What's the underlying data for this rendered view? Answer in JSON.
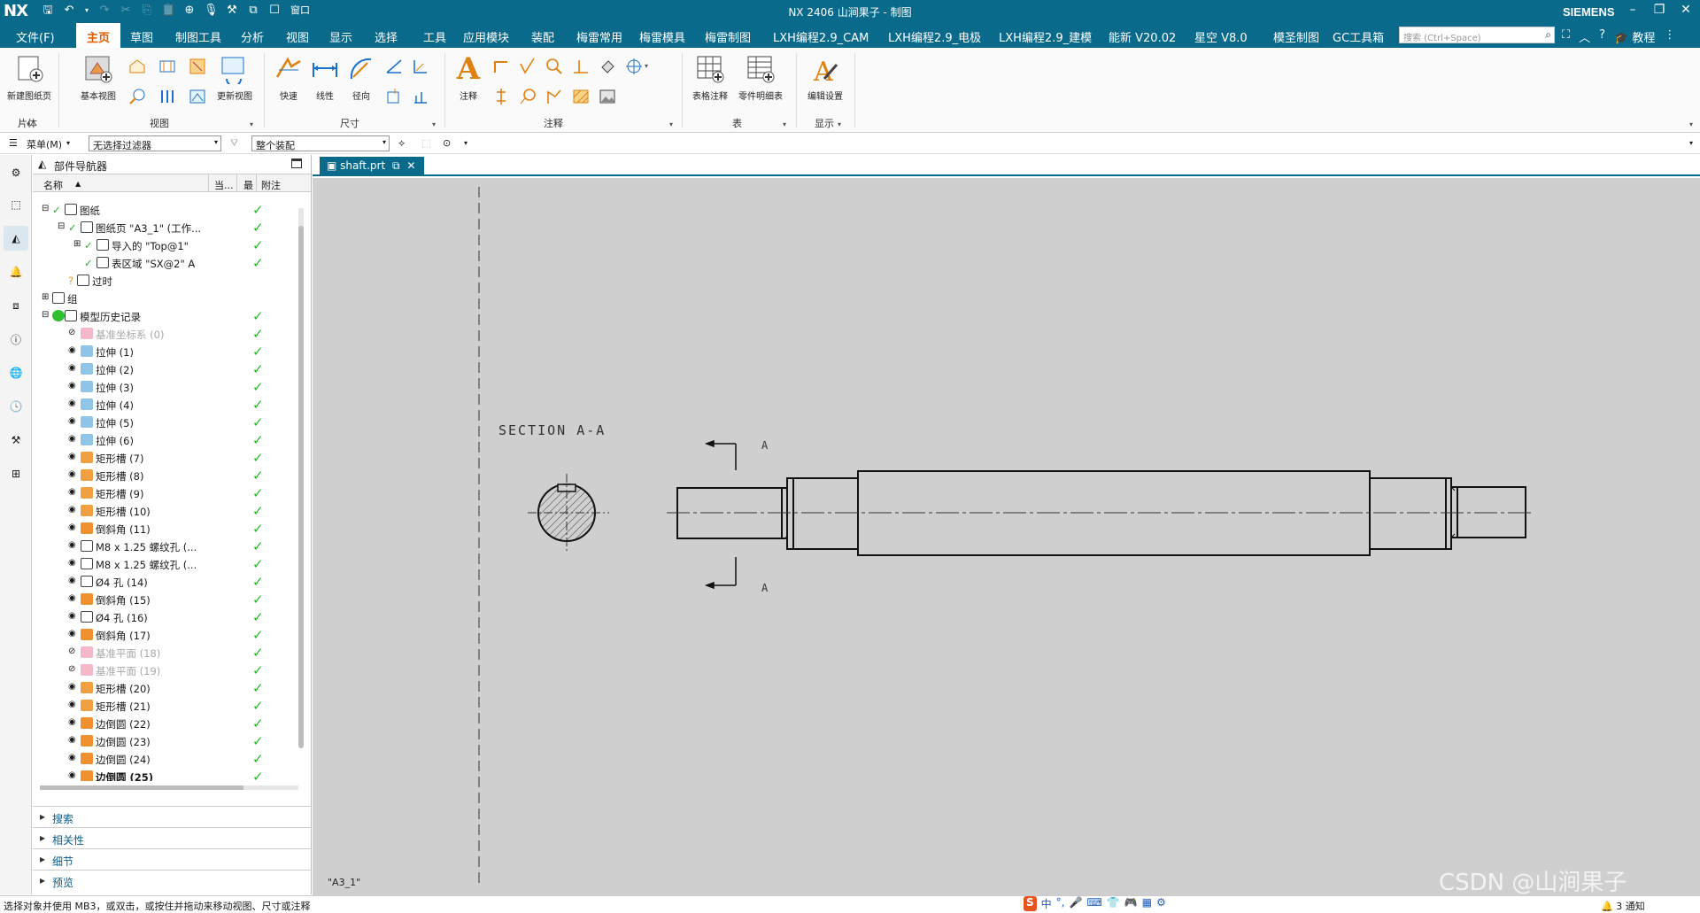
{
  "app": {
    "logo": "NX",
    "title": "NX 2406 山涧果子 - 制图",
    "brand": "SIEMENS",
    "window_label": "窗口"
  },
  "menu": {
    "items": [
      "文件(F)",
      "主页",
      "草图",
      "制图工具",
      "分析",
      "视图",
      "显示",
      "选择",
      "工具",
      "应用模块",
      "装配",
      "梅雷常用",
      "梅雷模具",
      "梅雷制图",
      "LXH编程2.9_CAM",
      "LXH编程2.9_电极",
      "LXH编程2.9_建模",
      "能新 V20.02",
      "星空 V8.0",
      "模圣制图",
      "GC工具箱"
    ],
    "active": "主页",
    "search_placeholder": "搜索 (Ctrl+Space)",
    "tutorial": "教程"
  },
  "ribbon": {
    "groups": [
      "片体",
      "视图",
      "尺寸",
      "注释",
      "表",
      "显示"
    ],
    "buttons": {
      "new_sheet": "新建图纸页",
      "base_view": "基本视图",
      "update_view": "更新视图",
      "quick": "快速",
      "linear": "线性",
      "radial": "径向",
      "note": "注释",
      "table_note": "表格注释",
      "parts_list": "零件明细表",
      "edit_settings": "编辑设置"
    }
  },
  "toolbar2": {
    "menu": "菜单(M)",
    "filter": "无选择过滤器",
    "assembly": "整个装配"
  },
  "navigator": {
    "title": "部件导航器",
    "columns": [
      "名称",
      "当...",
      "最",
      "附注"
    ],
    "sections": [
      "搜索",
      "相关性",
      "细节",
      "预览"
    ]
  },
  "tree": [
    {
      "label": "图纸",
      "indent": 0,
      "exp": "−",
      "check": true,
      "tick": true
    },
    {
      "label": "图纸页 \"A3_1\" (工作...",
      "indent": 1,
      "exp": "−",
      "check": true,
      "tick": true
    },
    {
      "label": "导入的 \"Top@1\"",
      "indent": 2,
      "exp": "+",
      "check": true,
      "tick": true
    },
    {
      "label": "表区域 \"SX@2\" A",
      "indent": 2,
      "exp": "",
      "check": true,
      "tick": true
    },
    {
      "label": "过时",
      "indent": 1,
      "exp": "",
      "check": false,
      "tick": false,
      "q": true
    },
    {
      "label": "组",
      "indent": 0,
      "exp": "+",
      "check": false,
      "tick": false
    },
    {
      "label": "模型历史记录",
      "indent": 0,
      "exp": "−",
      "check": false,
      "tick": true,
      "green": true
    },
    {
      "label": "基准坐标系 (0)",
      "indent": 1,
      "grey": true,
      "tick": true
    },
    {
      "label": "拉伸 (1)",
      "indent": 1,
      "tick": true
    },
    {
      "label": "拉伸 (2)",
      "indent": 1,
      "tick": true
    },
    {
      "label": "拉伸 (3)",
      "indent": 1,
      "tick": true
    },
    {
      "label": "拉伸 (4)",
      "indent": 1,
      "tick": true
    },
    {
      "label": "拉伸 (5)",
      "indent": 1,
      "tick": true
    },
    {
      "label": "拉伸 (6)",
      "indent": 1,
      "tick": true
    },
    {
      "label": "矩形槽 (7)",
      "indent": 1,
      "tick": true
    },
    {
      "label": "矩形槽 (8)",
      "indent": 1,
      "tick": true
    },
    {
      "label": "矩形槽 (9)",
      "indent": 1,
      "tick": true
    },
    {
      "label": "矩形槽 (10)",
      "indent": 1,
      "tick": true
    },
    {
      "label": "倒斜角 (11)",
      "indent": 1,
      "tick": true
    },
    {
      "label": "M8 x 1.25 螺纹孔 (...",
      "indent": 1,
      "tick": true
    },
    {
      "label": "M8 x 1.25 螺纹孔 (...",
      "indent": 1,
      "tick": true
    },
    {
      "label": "Ø4 孔 (14)",
      "indent": 1,
      "tick": true
    },
    {
      "label": "倒斜角 (15)",
      "indent": 1,
      "tick": true
    },
    {
      "label": "Ø4 孔 (16)",
      "indent": 1,
      "tick": true
    },
    {
      "label": "倒斜角 (17)",
      "indent": 1,
      "tick": true
    },
    {
      "label": "基准平面 (18)",
      "indent": 1,
      "grey": true,
      "tick": true
    },
    {
      "label": "基准平面 (19)",
      "indent": 1,
      "grey": true,
      "tick": true
    },
    {
      "label": "矩形槽 (20)",
      "indent": 1,
      "tick": true
    },
    {
      "label": "矩形槽 (21)",
      "indent": 1,
      "tick": true
    },
    {
      "label": "边倒圆 (22)",
      "indent": 1,
      "tick": true
    },
    {
      "label": "边倒圆 (23)",
      "indent": 1,
      "tick": true
    },
    {
      "label": "边倒圆 (24)",
      "indent": 1,
      "tick": true
    },
    {
      "label": "边倒圆 (25)",
      "indent": 1,
      "tick": true
    }
  ],
  "tab": {
    "label": "shaft.prt"
  },
  "drawing": {
    "section_label": "SECTION  A-A",
    "cut_letter": "A",
    "sheet_label": "\"A3_1\""
  },
  "status": {
    "message": "选择对象并使用 MB3，或双击，或按住并拖动来移动视图、尺寸或注释",
    "notifications": "3 通知",
    "ime": [
      "S",
      "中",
      "°,",
      "🎤",
      "⌨",
      "👕",
      "🎮",
      "▦",
      "⚙"
    ]
  },
  "watermark": "CSDN @山涧果子",
  "colors": {
    "title_bg": "#0a6a8c",
    "active_menu": "#e05a00",
    "canvas": "#cfcfcf",
    "check": "#22b722"
  }
}
